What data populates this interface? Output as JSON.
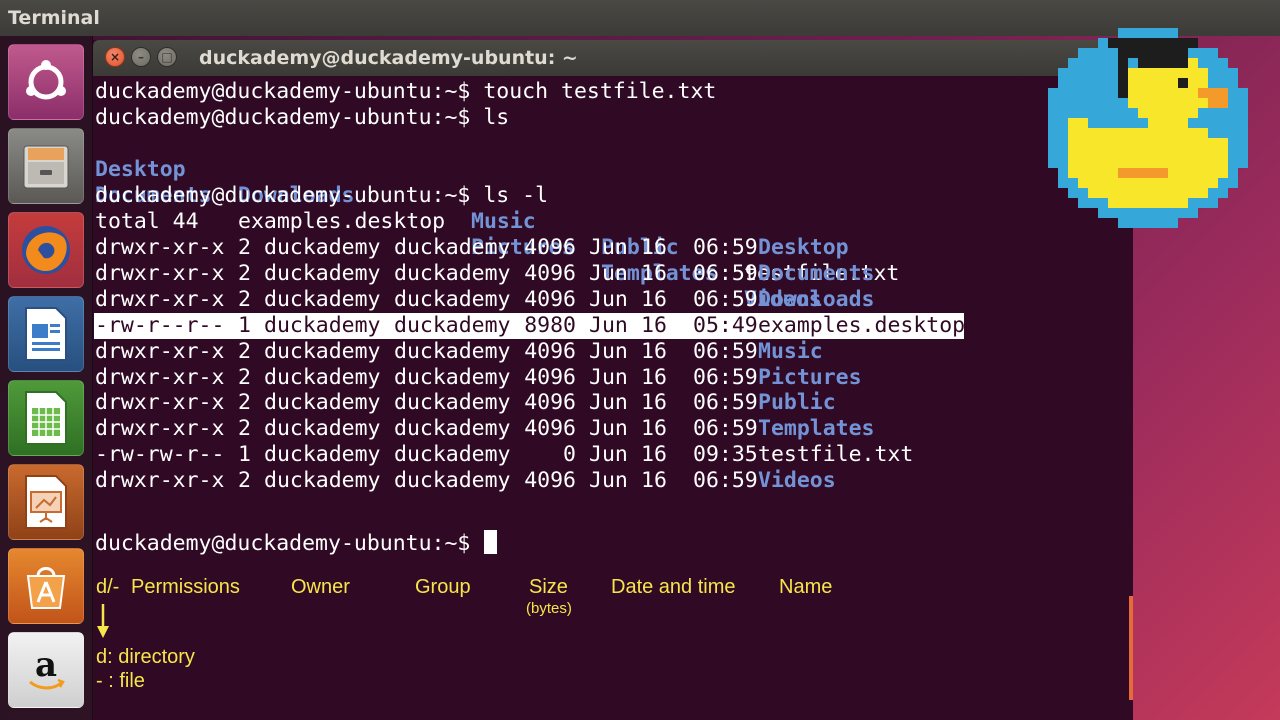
{
  "top_panel": {
    "title": "Terminal"
  },
  "launcher": {
    "items": [
      {
        "name": "ubuntu-dash-icon"
      },
      {
        "name": "files-icon"
      },
      {
        "name": "firefox-icon"
      },
      {
        "name": "writer-icon"
      },
      {
        "name": "calc-icon"
      },
      {
        "name": "impress-icon"
      },
      {
        "name": "software-center-icon"
      },
      {
        "name": "amazon-icon"
      }
    ]
  },
  "window": {
    "title": "duckademy@duckademy-ubuntu: ~",
    "close_glyph": "×",
    "min_glyph": "–",
    "max_glyph": "□"
  },
  "terminal": {
    "prompt": "duckademy@duckademy-ubuntu:~$",
    "commands": [
      "touch testfile.txt",
      "ls",
      "ls -l"
    ],
    "ls_short": {
      "row1": [
        "Desktop",
        "Downloads",
        "Music",
        "Public",
        "testfile.txt"
      ],
      "row2": [
        "Documents",
        "examples.desktop",
        "Pictures",
        "Templates",
        "Videos"
      ]
    },
    "total": "total 44",
    "long_listing": [
      {
        "perm": "drwxr-xr-x",
        "links": "2",
        "owner": "duckademy",
        "group": "duckademy",
        "size": "4096",
        "month": "Jun",
        "day": "16",
        "time": "06:59",
        "name": "Desktop",
        "is_dir": true
      },
      {
        "perm": "drwxr-xr-x",
        "links": "2",
        "owner": "duckademy",
        "group": "duckademy",
        "size": "4096",
        "month": "Jun",
        "day": "16",
        "time": "06:59",
        "name": "Documents",
        "is_dir": true
      },
      {
        "perm": "drwxr-xr-x",
        "links": "2",
        "owner": "duckademy",
        "group": "duckademy",
        "size": "4096",
        "month": "Jun",
        "day": "16",
        "time": "06:59",
        "name": "Downloads",
        "is_dir": true
      },
      {
        "perm": "-rw-r--r--",
        "links": "1",
        "owner": "duckademy",
        "group": "duckademy",
        "size": "8980",
        "month": "Jun",
        "day": "16",
        "time": "05:49",
        "name": "examples.desktop",
        "is_dir": false,
        "highlighted": true
      },
      {
        "perm": "drwxr-xr-x",
        "links": "2",
        "owner": "duckademy",
        "group": "duckademy",
        "size": "4096",
        "month": "Jun",
        "day": "16",
        "time": "06:59",
        "name": "Music",
        "is_dir": true
      },
      {
        "perm": "drwxr-xr-x",
        "links": "2",
        "owner": "duckademy",
        "group": "duckademy",
        "size": "4096",
        "month": "Jun",
        "day": "16",
        "time": "06:59",
        "name": "Pictures",
        "is_dir": true
      },
      {
        "perm": "drwxr-xr-x",
        "links": "2",
        "owner": "duckademy",
        "group": "duckademy",
        "size": "4096",
        "month": "Jun",
        "day": "16",
        "time": "06:59",
        "name": "Public",
        "is_dir": true
      },
      {
        "perm": "drwxr-xr-x",
        "links": "2",
        "owner": "duckademy",
        "group": "duckademy",
        "size": "4096",
        "month": "Jun",
        "day": "16",
        "time": "06:59",
        "name": "Templates",
        "is_dir": true
      },
      {
        "perm": "-rw-rw-r--",
        "links": "1",
        "owner": "duckademy",
        "group": "duckademy",
        "size": "0",
        "month": "Jun",
        "day": "16",
        "time": "09:35",
        "name": "testfile.txt",
        "is_dir": false
      },
      {
        "perm": "drwxr-xr-x",
        "links": "2",
        "owner": "duckademy",
        "group": "duckademy",
        "size": "4096",
        "month": "Jun",
        "day": "16",
        "time": "06:59",
        "name": "Videos",
        "is_dir": true
      }
    ]
  },
  "annotations": {
    "columns": [
      "d/-",
      "Permissions",
      "Owner",
      "Group",
      "Size",
      "Date and time",
      "Name"
    ],
    "size_unit": "(bytes)",
    "legend_dir": "d: directory",
    "legend_file": "- : file"
  },
  "colors": {
    "terminal_bg": "#300a24",
    "directory": "#7393d6",
    "annotation": "#f5e64b"
  }
}
